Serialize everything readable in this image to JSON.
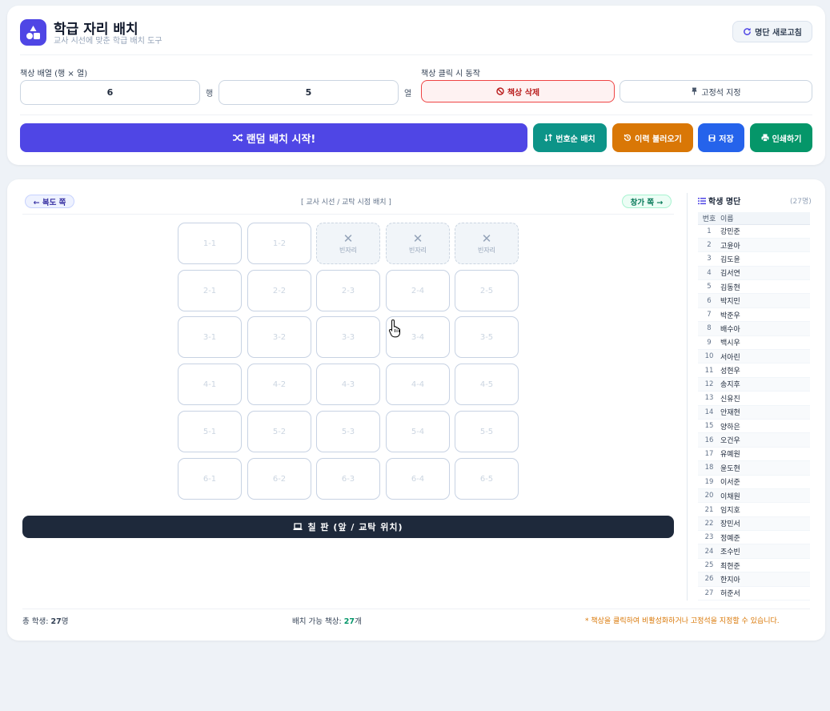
{
  "header": {
    "title": "학급 자리 배치",
    "subtitle": "교사 시선에 맞춘 학급 배치 도구",
    "refresh_label": "명단 새로고침"
  },
  "config": {
    "layout_label": "책상 배열 (행 × 열)",
    "rows_value": "6",
    "rows_unit": "행",
    "cols_value": "5",
    "cols_unit": "열",
    "click_label": "책상 클릭 시 동작",
    "delete_label": "책상 삭제",
    "fix_label": "고정석 지정"
  },
  "actions": {
    "random_label": "랜덤 배치 시작!",
    "order_label": "번호순 배치",
    "history_label": "이력 불러오기",
    "save_label": "저장",
    "print_label": "인쇄하기"
  },
  "classroom": {
    "left_label": "← 복도 쪽",
    "center_label": "[ 교사 시선 / 교탁 시점 배치 ]",
    "right_label": "창가 쪽 →",
    "board_label": "칠 판 (앞 / 교탁 위치)",
    "empty_label": "빈자리",
    "empty_mark": "✕",
    "seats": [
      [
        "1-1",
        "1-2",
        "빈자리",
        "빈자리",
        "빈자리"
      ],
      [
        "2-1",
        "2-2",
        "2-3",
        "2-4",
        "2-5"
      ],
      [
        "3-1",
        "3-2",
        "3-3",
        "3-4",
        "3-5"
      ],
      [
        "4-1",
        "4-2",
        "4-3",
        "4-4",
        "4-5"
      ],
      [
        "5-1",
        "5-2",
        "5-3",
        "5-4",
        "5-5"
      ],
      [
        "6-1",
        "6-2",
        "6-3",
        "6-4",
        "6-5"
      ]
    ]
  },
  "roster": {
    "title": "학생 명단",
    "count": "(27명)",
    "col_num": "번호",
    "col_name": "이름",
    "students": [
      "강민준",
      "고윤아",
      "김도윤",
      "김서연",
      "김동현",
      "박지민",
      "박준우",
      "배수아",
      "백시우",
      "서아린",
      "성현우",
      "송지후",
      "신유진",
      "안재현",
      "양하은",
      "오건우",
      "유예원",
      "윤도현",
      "이서준",
      "이채원",
      "임지호",
      "장민서",
      "정예준",
      "조수빈",
      "최현준",
      "한지아",
      "허준서"
    ]
  },
  "footer": {
    "total_prefix": "총 학생: ",
    "total_value": "27",
    "total_suffix": "명",
    "avail_prefix": "배치 가능 책상: ",
    "avail_value": "27",
    "avail_suffix": "개",
    "hint": "* 책상을 클릭하여 비활성화하거나 고정석을 지정할 수 있습니다."
  },
  "colors": {
    "brand": "#4f46e5",
    "teal": "#0d9488",
    "amber": "#d97706",
    "blue": "#2563eb",
    "green": "#059669",
    "danger": "#dc2626",
    "board": "#1e293b"
  }
}
